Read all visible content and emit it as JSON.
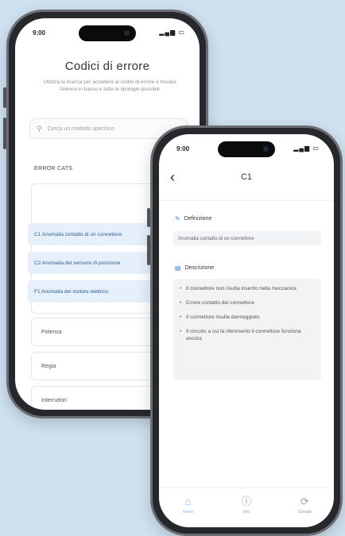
{
  "colors": {
    "background": "#cfe1f0",
    "accent": "#3d7fd1",
    "highlight": "#e6f0fb"
  },
  "back_screen": {
    "status_time": "9:00",
    "status_icons": "▂▄▆ ▭",
    "title": "Codici di errore",
    "description": "Utilizza la ricerca per accedere ai codici di errore o trovare l'elenco in basso e tutte le tipologie possibili",
    "search": {
      "placeholder": "Cerca un modello specifico"
    },
    "section_label": "ERROR CATS",
    "code_items": [
      {
        "label": "C1 Anomalia contatto di un connettore"
      },
      {
        "label": "C2 Anomalia del sensore di posizione"
      },
      {
        "label": "F1 Anomalia del motore elettrico"
      }
    ],
    "categories": [
      {
        "label": "Potenza"
      },
      {
        "label": "Regia"
      },
      {
        "label": "Interruttori"
      }
    ]
  },
  "front_screen": {
    "status_time": "9:00",
    "status_icons": "▂▄▆ ▭",
    "title": "C1",
    "definition": {
      "heading": "Definizione",
      "text": "Anomalia contatto di un connettore"
    },
    "causes": {
      "heading": "Descrizione",
      "items": [
        {
          "text": "Il connettore non risulta inserito nella meccanica"
        },
        {
          "text": "Errore contatto del connettore"
        },
        {
          "text": "Il connettore risulta danneggiato"
        },
        {
          "text": "Il circuito a cui fa riferimento il connettore funziona ancora"
        }
      ]
    },
    "tabs": [
      {
        "label": "Home",
        "icon": "home-icon"
      },
      {
        "label": "Info",
        "icon": "info-icon"
      },
      {
        "label": "Contatti",
        "icon": "refresh-icon"
      }
    ]
  }
}
